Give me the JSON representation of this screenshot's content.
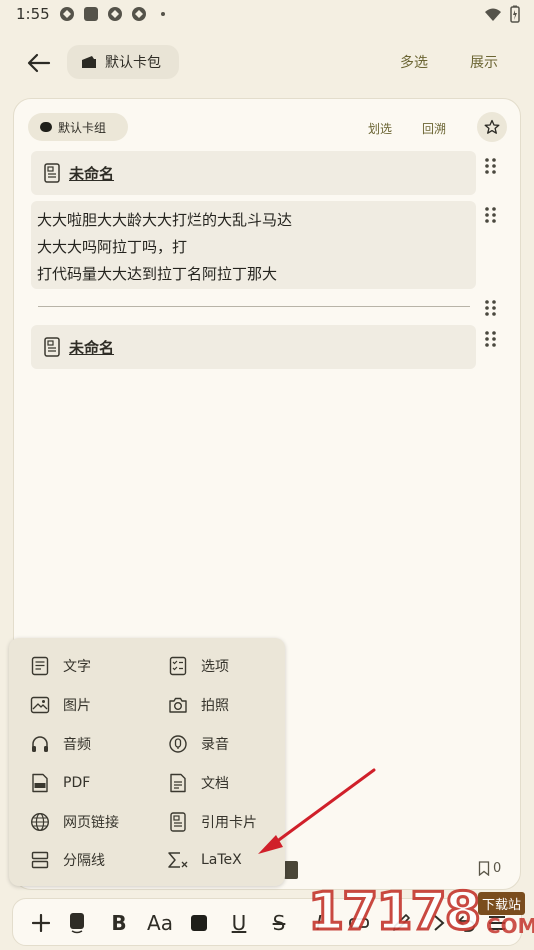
{
  "status_bar": {
    "time": "1:55"
  },
  "header": {
    "wallet_label": "默认卡包",
    "multi_select": "多选",
    "display": "展示"
  },
  "card": {
    "group_label": "默认卡组",
    "action_cross": "划选",
    "action_trace": "回溯",
    "blocks": [
      {
        "title": "未命名"
      },
      {
        "lines": [
          "大大啦胆大大龄大大打烂的大乱斗马达",
          "大大大吗阿拉丁吗，打",
          "打代码量大大达到拉丁名阿拉丁那大"
        ]
      },
      {
        "title": "未命名"
      }
    ],
    "bookmark_count": "0"
  },
  "insert_menu": {
    "items": [
      {
        "label": "文字",
        "icon": "text-doc-icon"
      },
      {
        "label": "选项",
        "icon": "checklist-icon"
      },
      {
        "label": "图片",
        "icon": "image-icon"
      },
      {
        "label": "拍照",
        "icon": "camera-icon"
      },
      {
        "label": "音频",
        "icon": "headphones-icon"
      },
      {
        "label": "录音",
        "icon": "microphone-icon"
      },
      {
        "label": "PDF",
        "icon": "pdf-icon"
      },
      {
        "label": "文档",
        "icon": "document-icon"
      },
      {
        "label": "网页链接",
        "icon": "globe-icon"
      },
      {
        "label": "引用卡片",
        "icon": "quote-card-icon"
      },
      {
        "label": "分隔线",
        "icon": "divider-icon"
      },
      {
        "label": "LaTeX",
        "icon": "sigma-icon"
      }
    ]
  },
  "toolbar": {
    "bold": "B",
    "font_size": "Aa",
    "underline": "U",
    "strike": "S",
    "italic": "I"
  },
  "watermark": {
    "digits": "17178",
    "tag": "下载站",
    "domain": "COM"
  },
  "colors": {
    "accent": "#6b6533",
    "background": "#f4efe2",
    "arrow": "#d0202a"
  }
}
